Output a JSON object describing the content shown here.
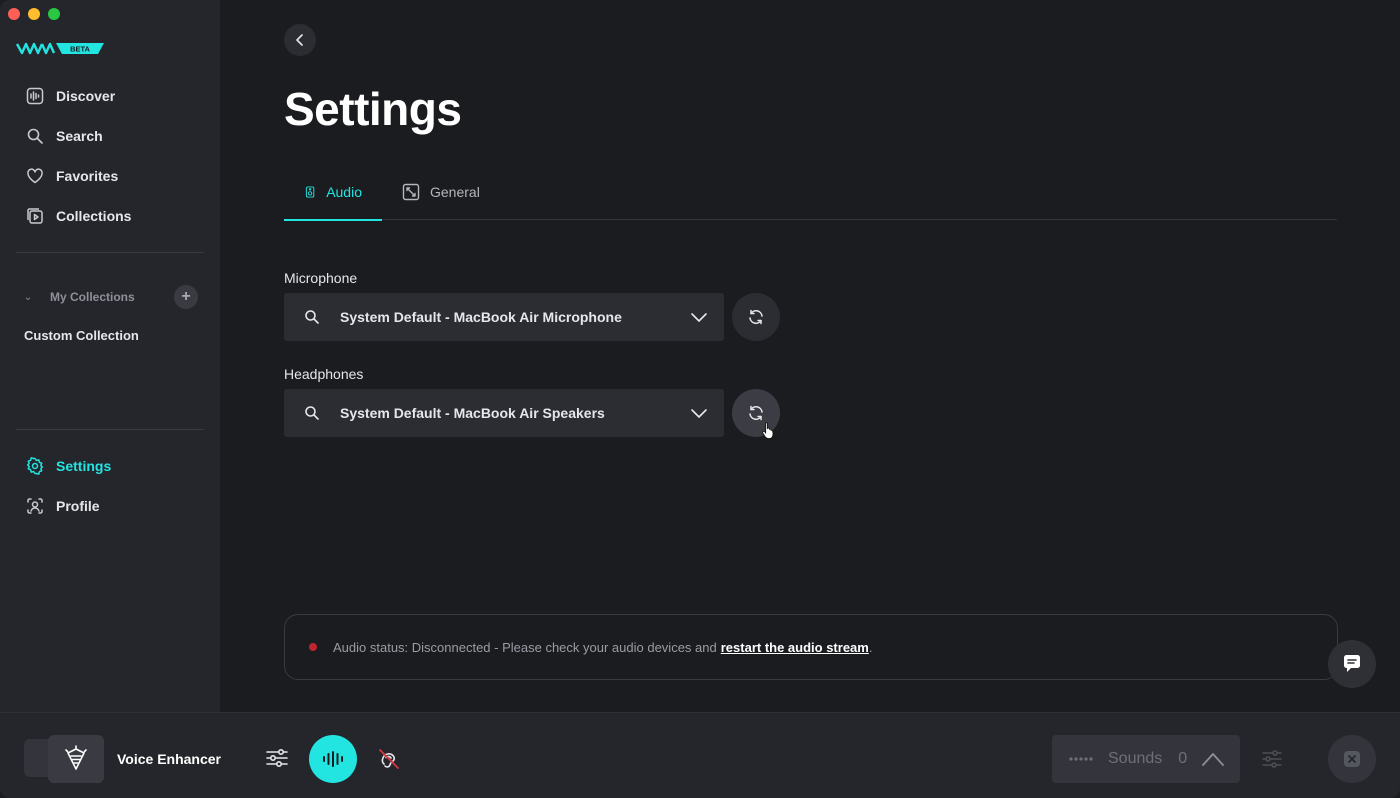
{
  "sidebar": {
    "logo_badge": "BETA",
    "nav": [
      {
        "label": "Discover",
        "icon": "waveform-icon"
      },
      {
        "label": "Search",
        "icon": "search-icon"
      },
      {
        "label": "Favorites",
        "icon": "heart-icon"
      },
      {
        "label": "Collections",
        "icon": "collections-icon"
      }
    ],
    "my_collections": {
      "label": "My Collections",
      "add": "+"
    },
    "custom_collection": "Custom Collection",
    "bottom_nav": [
      {
        "label": "Settings",
        "icon": "gear-icon",
        "active": true
      },
      {
        "label": "Profile",
        "icon": "profile-icon"
      }
    ]
  },
  "main": {
    "title": "Settings",
    "tabs": [
      {
        "label": "Audio",
        "active": true
      },
      {
        "label": "General",
        "active": false
      }
    ],
    "microphone": {
      "label": "Microphone",
      "value": "System Default - MacBook Air Microphone"
    },
    "headphones": {
      "label": "Headphones",
      "value": "System Default - MacBook Air Speakers"
    },
    "status": {
      "text": "Audio status: Disconnected - Please check your audio devices and",
      "link": "restart the audio stream",
      "suffix": "."
    }
  },
  "bottombar": {
    "voice_name": "Voice Enhancer",
    "sounds_label": "Sounds",
    "sounds_count": "0"
  },
  "colors": {
    "accent": "#22e5e2",
    "sidebar_bg": "#25262c",
    "main_bg": "#1b1c20",
    "status_dot": "#c0242c"
  }
}
